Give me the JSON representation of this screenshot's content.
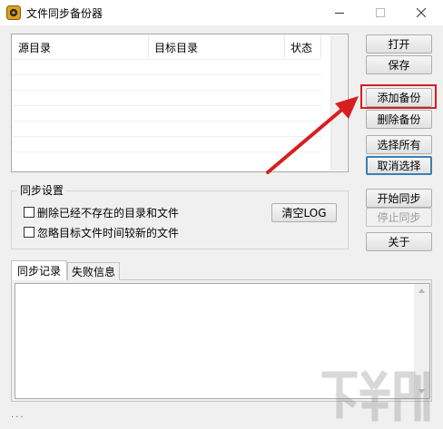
{
  "window": {
    "title": "文件同步备份器",
    "controls": [
      "minimize-icon",
      "maximize-icon",
      "close-icon"
    ]
  },
  "file_list": {
    "columns": [
      "源目录",
      "目标目录",
      "状态"
    ],
    "rows": []
  },
  "side_buttons": {
    "open": "打开",
    "save": "保存",
    "add_backup": "添加备份",
    "delete_backup": "删除备份",
    "select_all": "选择所有",
    "cancel_select": "取消选择",
    "start_sync": "开始同步",
    "stop_sync": "停止同步",
    "about": "关于"
  },
  "sync_settings": {
    "legend": "同步设置",
    "delete_missing_label": "删除已经不存在的目录和文件",
    "delete_missing_checked": false,
    "ignore_newer_label": "忽略目标文件时间较新的文件",
    "ignore_newer_checked": false,
    "clear_log_button": "清空LOG"
  },
  "tabs": [
    {
      "label": "同步记录",
      "active": true
    },
    {
      "label": "失败信息",
      "active": false
    }
  ],
  "log": {
    "content": ""
  },
  "status_bar": {
    "text": "..."
  },
  "annotation": {
    "color": "#d81e1e",
    "target": "add_backup"
  },
  "watermark": {
    "logo": "download-site-logo"
  }
}
